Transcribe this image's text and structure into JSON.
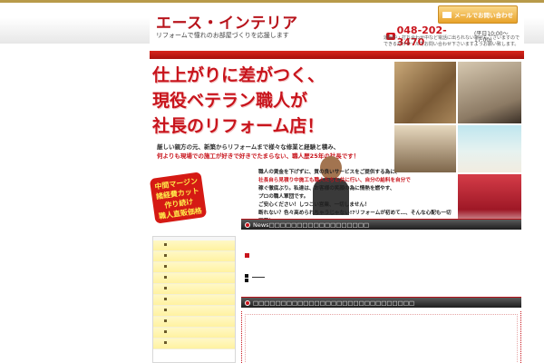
{
  "header": {
    "logo": "エース・インテリア",
    "tagline": "リフォームで憧れのお部屋づくりを応援します",
    "phone": "048-202-3470",
    "hours": "(平日10:00～17:00)",
    "mail_button": "メールでお問い合わせ",
    "mail_note": "運転中・打ち合わせ中など電話に出られない場合もございますのでできるだけメールでお問い合わせ下さいますようお願い致します。"
  },
  "hero": {
    "headline": [
      "仕上がりに差がつく、",
      "現役ベテラン職人が",
      "社長のリフォーム店！"
    ],
    "sub1": "厳しい親方の元、新築からリフォームまで様々な修業と経験と積み、",
    "sub2": "何よりも現場での施工が好きで好きでたまらない、職人歴25年の社長です！",
    "badge": [
      "中間マージン",
      "諸経費カット",
      "作り続け",
      "職人直販価格"
    ],
    "body": [
      "職人の賃金を下げずに、質の良いサービスをご提供する為に、",
      "社長自ら見積り中施工も職人たちと共に行い、自分の給料を自分で",
      "稼ぐ徹底ぶり。私達は、お客様の笑顔の為に情熱を燃やす、",
      "プロの職人軍団です。",
      "ご安心ください！しつこい営業、一切しません！",
      "断れない？色々高められちゃうじゃない!?リフォームが初めて…、そんな心配も一切不要！"
    ]
  },
  "news": {
    "title": "News□□□□□□□□□□□□□□□□□□"
  },
  "section2": {
    "title": "□□□□□□□□□□□□□□□□□□□□□□□□□□□□□"
  },
  "colors": {
    "brand_red": "#c8141c",
    "nav_red": "#d8261c",
    "mail_orange": "#e8a22a",
    "sidebar_yellow": "#fff2a0"
  }
}
